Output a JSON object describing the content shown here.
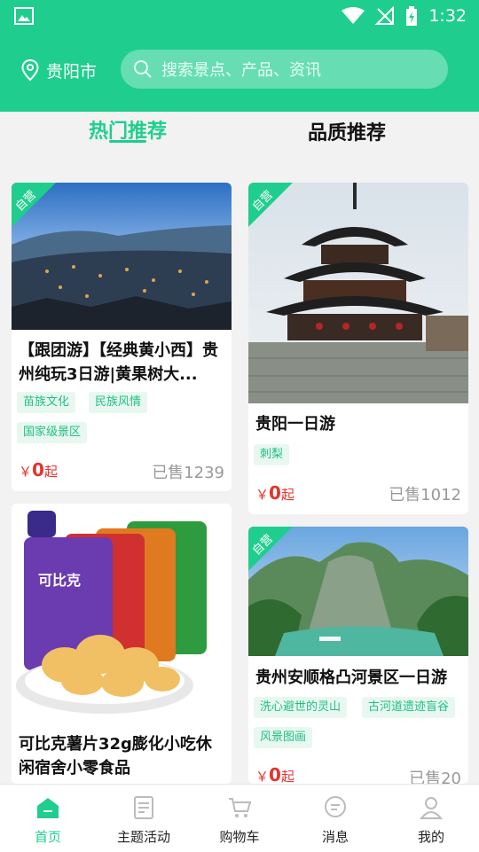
{
  "status_bar": {
    "time": "1:32"
  },
  "header": {
    "location": "贵阳市",
    "search_placeholder": "搜索景点、产品、资讯"
  },
  "tabs": [
    {
      "label": "热门推荐",
      "active": true
    },
    {
      "label": "品质推荐",
      "active": false
    }
  ],
  "products": [
    {
      "title": "【跟团游】【经典黄小西】贵州纯玩3日游|黄果树大...",
      "badge": "自营",
      "tags": [
        "苗族文化",
        "民族风情",
        "国家级景区"
      ],
      "price_symbol": "￥",
      "price_value": "0",
      "price_suffix": "起",
      "sold": "已售1239"
    },
    {
      "title": "贵阳一日游",
      "badge": "自营",
      "tags": [
        "刺梨"
      ],
      "price_symbol": "￥",
      "price_value": "0",
      "price_suffix": "起",
      "sold": "已售1012"
    },
    {
      "title": "可比克薯片32g膨化小吃休闲宿舍小零食品",
      "badge": "",
      "tags": [],
      "sold": ""
    },
    {
      "title": "贵州安顺格凸河景区一日游",
      "badge": "自营",
      "tags": [
        "洗心避世的灵山",
        "古河道遗迹盲谷",
        "风景图画"
      ],
      "price_symbol": "￥",
      "price_value": "0",
      "price_suffix": "起",
      "sold": "已售20"
    }
  ],
  "bottom_nav": [
    {
      "label": "首页",
      "icon": "home-icon",
      "active": true
    },
    {
      "label": "主题活动",
      "icon": "document-icon",
      "active": false
    },
    {
      "label": "购物车",
      "icon": "cart-icon",
      "active": false
    },
    {
      "label": "消息",
      "icon": "message-icon",
      "active": false
    },
    {
      "label": "我的",
      "icon": "user-icon",
      "active": false
    }
  ],
  "colors": {
    "brand_green": "#1fce8e",
    "price_red": "#e8322b",
    "tag_bg": "#e8f8f1"
  }
}
